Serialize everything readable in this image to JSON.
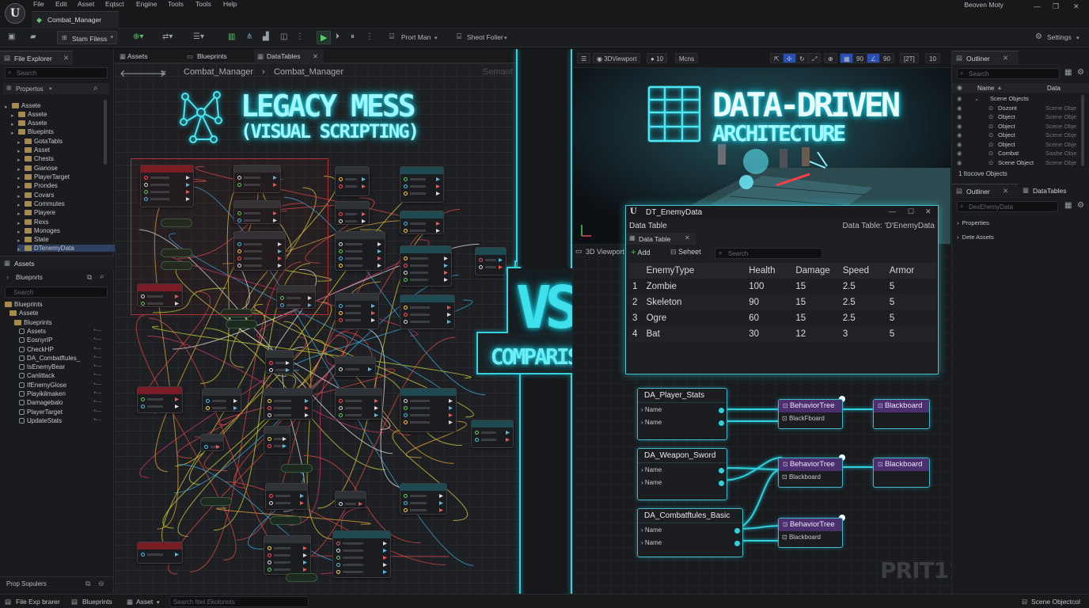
{
  "menubar": {
    "items": [
      "File",
      "Edit",
      "Asset",
      "Eqtsct",
      "Engine",
      "Tools",
      "Tools",
      "Help"
    ],
    "doc_tab": "Combat_Manager",
    "project_name": "Beoven Moty"
  },
  "toolbar": {
    "save_current": "Stam Filess",
    "platform_menu": "Prort Man",
    "sheet_folder": "Sheot Folier",
    "settings": "Settings"
  },
  "left_panel": {
    "file_explorer_tab": "File Explorer",
    "search_placeholder": "Search",
    "properties_label": "Propertos",
    "tree": [
      "Assete",
      "Assete",
      "Assete",
      "Bluepints",
      "GotaTabls",
      "Asset",
      "Chests",
      "Gianose",
      "PlayerTarget",
      "Prondes",
      "Covars",
      "Commutes",
      "Playere",
      "Rexs",
      "Monoges",
      "State",
      "DTenemyData"
    ],
    "assets_tab": "Assets",
    "blueprints_label": "Bluepnrts",
    "search2_placeholder": "Search",
    "tree2": [
      "Blueprints",
      "Assete",
      "Blueprints",
      "Assets",
      "EosnyrIP",
      "CheckHP",
      "DA_Combatftules_",
      "IsEnemyBear",
      "Canlittack",
      "IfEnemyGlose",
      "Playikilmaken",
      "Damagebalo",
      "PlayerTarget",
      "UpdateStats"
    ],
    "footer_label": "Prop Sopulers"
  },
  "graph_tabs": [
    "Assets",
    "Blueprints",
    "DataTables"
  ],
  "breadcrumb": {
    "part1": "Combat_Manager",
    "part2": "Combat_Manager",
    "faded": "Semant"
  },
  "left_title": {
    "line1": "LEGACY MESS",
    "line2": "(VISUAL SCRIPTING)"
  },
  "vs": {
    "big": "VS",
    "label": "COMPARISON"
  },
  "viewport": {
    "mode": "3DViewport",
    "fov": "10",
    "menu": "Mcns",
    "snap1": "90",
    "snap2": "[2T]",
    "snap3": "10",
    "label": "3D Viewport"
  },
  "right_title": {
    "line1": "DATA-DRIVEN",
    "line2": "ARCHITECTURE"
  },
  "datatable_window": {
    "title": "DT_EnemyData",
    "subtitle": "Data Table",
    "path_label": "Data Table: 'D'EnemyData",
    "tab": "Data Table",
    "add_label": "Add",
    "sheet_label": "Seheet",
    "search_placeholder": "Search",
    "columns": [
      "EnemyType",
      "Health",
      "Damage",
      "Speed",
      "Armor"
    ],
    "rows": [
      [
        "1",
        "Zombie",
        "100",
        "15",
        "2.5",
        "5"
      ],
      [
        "2",
        "Skeleton",
        "90",
        "15",
        "2.5",
        "5"
      ],
      [
        "3",
        "Ogre",
        "60",
        "15",
        "2.5",
        "5"
      ],
      [
        "4",
        "Bat",
        "30",
        "12",
        "3",
        "5"
      ]
    ]
  },
  "data_nodes": [
    {
      "title": "DA_Player_Stats",
      "pins": [
        "Name",
        "Name"
      ],
      "bt": "BehaviorTree",
      "bt_sub": "BlackFboard",
      "bb": "Blackboard"
    },
    {
      "title": "DA_Weapon_Sword",
      "pins": [
        "Name",
        "Name"
      ],
      "bt": "BehaviorTree",
      "bt_sub": "Blackboard",
      "bb": "Blackboard"
    },
    {
      "title": "DA_Combatftules_Basic",
      "pins": [
        "Name",
        "Name"
      ],
      "bt": "BehaviorTree",
      "bt_sub": "Blackboard"
    }
  ],
  "watermark": "PRIT11",
  "outliner": {
    "tab": "Outliner",
    "search_placeholder": "Search",
    "col_name": "Name",
    "col_type": "Data",
    "rows": [
      [
        "Scene Objects",
        ""
      ],
      [
        "Dozont",
        "Scene Obje"
      ],
      [
        "Object",
        "Scene Obje"
      ],
      [
        "Object",
        "Scene Obje"
      ],
      [
        "Object",
        "Scene Obje"
      ],
      [
        "Object",
        "Scene Obje"
      ],
      [
        "Combat",
        "Saahe Obje"
      ],
      [
        "Scene Object",
        "Scene Obje"
      ]
    ],
    "selected_count": "1 Itocove Objects",
    "tab2": "Outliner",
    "tab3": "DataTables",
    "search2_placeholder": "DexEhemyData",
    "sections": [
      "Properties",
      "Dete Assets"
    ]
  },
  "statusbar": {
    "file_explorer": "File Exp brarer",
    "blueprints": "Blueprints",
    "asset": "Asset",
    "search_placeholder": "Search Itiet Ekolonnts",
    "scene": "Scene Objectcol"
  },
  "colors": {
    "accent": "#33d0dd",
    "purple": "#4b2f6e",
    "folder": "#a88a4a"
  }
}
